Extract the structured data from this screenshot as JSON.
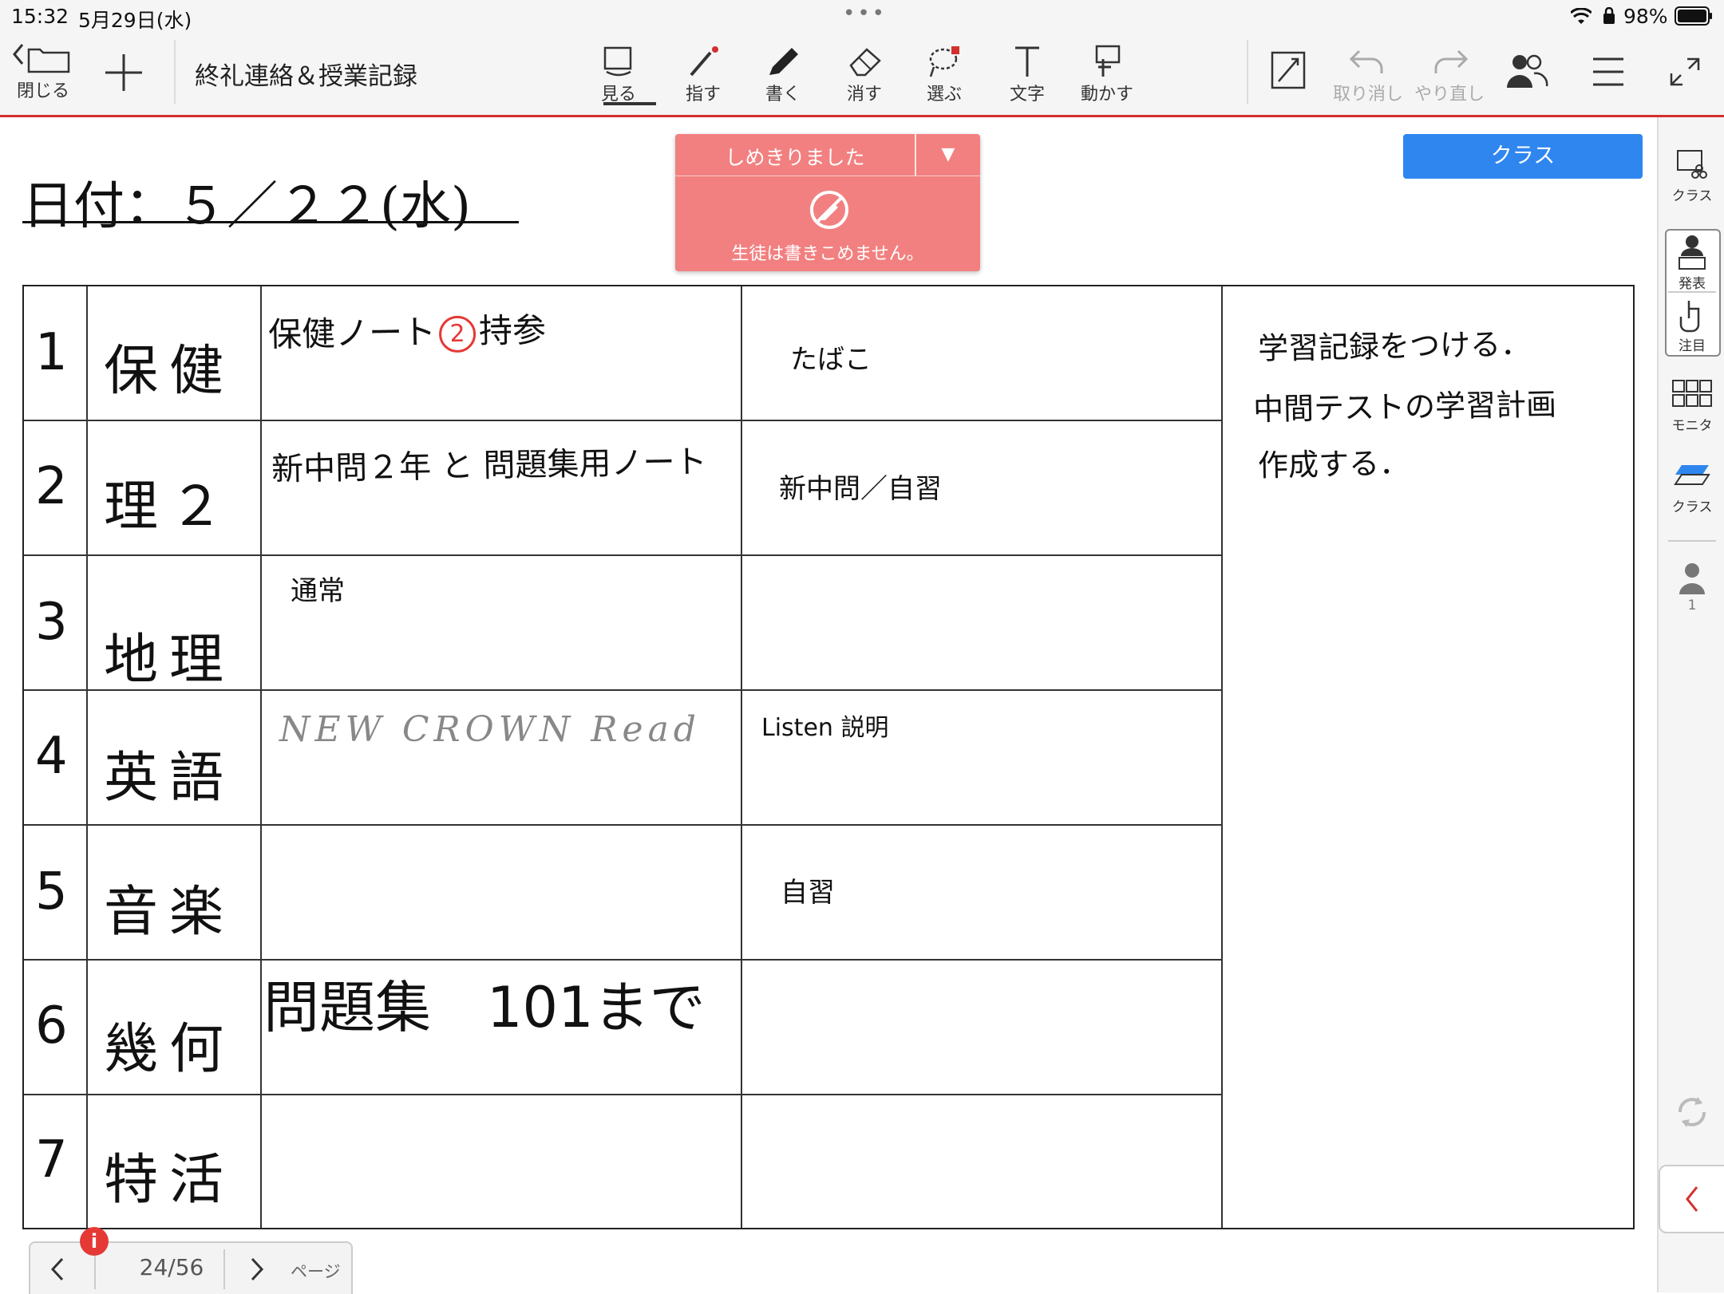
{
  "status_bar": {
    "time": "15:32",
    "date": "5月29日(水)",
    "battery": "98%"
  },
  "toolbar": {
    "close_label": "閉じる",
    "doc_title": "終礼連絡＆授業記録",
    "tools": {
      "view": "見る",
      "point": "指す",
      "write": "書く",
      "erase": "消す",
      "select": "選ぶ",
      "text": "文字",
      "move": "動かす"
    },
    "undo": "取り消し",
    "redo": "やり直し",
    "accent_color": "#d32f2f"
  },
  "banner": {
    "title": "しめきりました",
    "dropdown": "▼",
    "message": "生徒は書きこめません。",
    "color": "#f28080"
  },
  "class_button": "クラス",
  "sheet": {
    "date_text": "日付：５／２２(水)",
    "rows": [
      {
        "num": "1",
        "subject": "保健",
        "content_a": "保健ノート",
        "content_a_circled": "2",
        "content_a_suffix": "持参",
        "content_b": "たばこ"
      },
      {
        "num": "2",
        "subject": "理２",
        "content_a": "新中問２年 と 問題集用ノート",
        "content_b": "新中問／自習"
      },
      {
        "num": "3",
        "subject": "地理",
        "content_a": "通常",
        "content_b": ""
      },
      {
        "num": "4",
        "subject": "英語",
        "content_a": "NEW CROWN Read",
        "content_b": "Listen 説明"
      },
      {
        "num": "5",
        "subject": "音楽",
        "content_a": "",
        "content_b": "自習"
      },
      {
        "num": "6",
        "subject": "幾何",
        "content_a": "問題集　101まで",
        "content_b": ""
      },
      {
        "num": "7",
        "subject": "特活",
        "content_a": "",
        "content_b": ""
      }
    ],
    "notes": [
      "学習記録をつける．",
      "中間テストの学習計画",
      "作成する．"
    ]
  },
  "rail": {
    "class_top": "クラス",
    "present": "発表",
    "attention": "注目",
    "monitor": "モニタ",
    "class_layers": "クラス",
    "user_count": "1"
  },
  "pager": {
    "count": "24/56",
    "page_label": "ページ",
    "info": "i"
  }
}
